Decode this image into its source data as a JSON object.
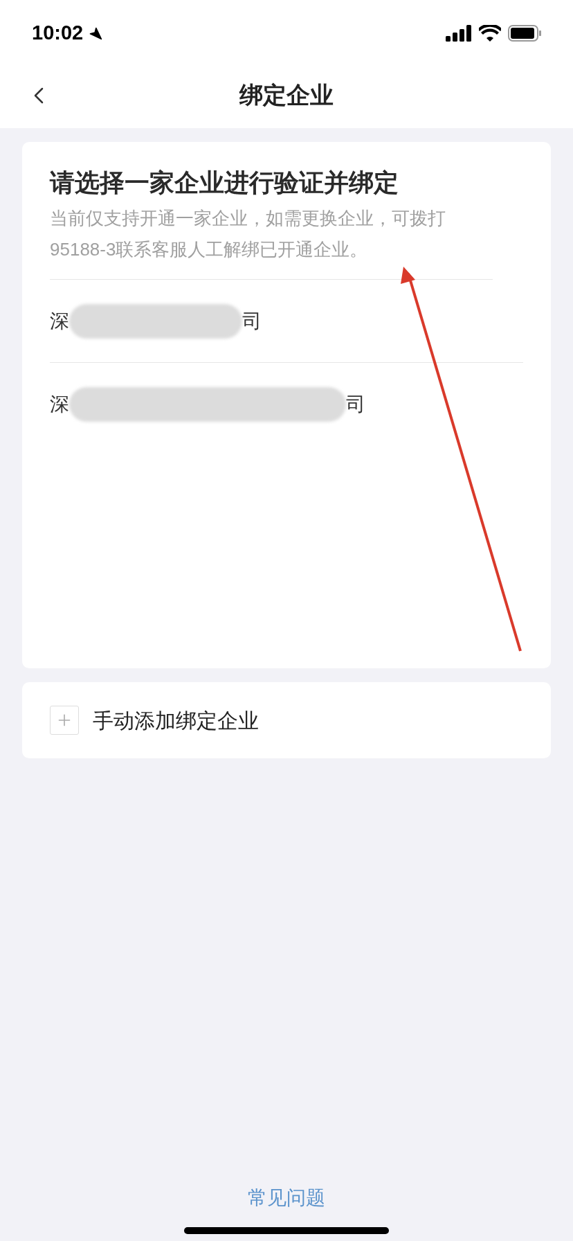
{
  "status_bar": {
    "time": "10:02"
  },
  "nav": {
    "title": "绑定企业"
  },
  "card": {
    "title": "请选择一家企业进行验证并绑定",
    "note": "当前仅支持开通一家企业，如需更换企业，可拨打95188-3联系客服人工解绑已开通企业。",
    "companies": [
      {
        "prefix": "深",
        "suffix": "司",
        "redacted": true
      },
      {
        "prefix": "深",
        "suffix": "司",
        "redacted": true
      }
    ]
  },
  "add": {
    "label": "手动添加绑定企业"
  },
  "footer": {
    "link": "常见问题"
  }
}
